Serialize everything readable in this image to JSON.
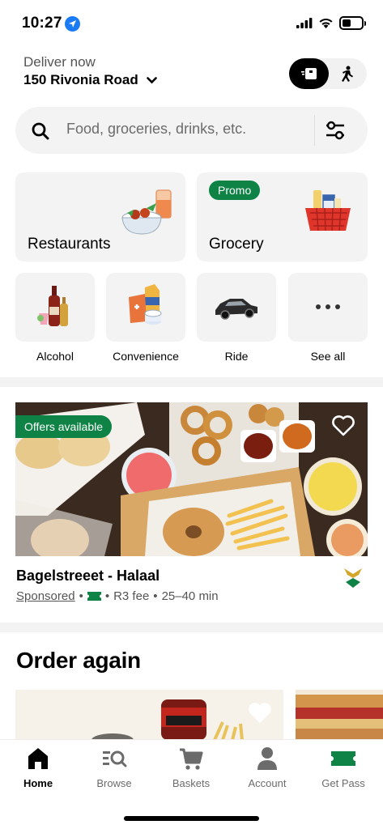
{
  "status_bar": {
    "time": "10:27",
    "battery_level": 0.45,
    "icons": [
      "location-arrow-icon",
      "cellular-signal-icon",
      "wifi-icon",
      "battery-icon"
    ]
  },
  "header": {
    "deliver_label": "Deliver now",
    "address": "150 Rivonia Road",
    "modes": [
      "delivery-icon",
      "pickup-icon"
    ],
    "active_mode": "delivery"
  },
  "search": {
    "placeholder": "Food, groceries, drinks, etc."
  },
  "categories": {
    "large": [
      {
        "label": "Restaurants",
        "badge": ""
      },
      {
        "label": "Grocery",
        "badge": "Promo"
      }
    ],
    "small": [
      {
        "label": "Alcohol"
      },
      {
        "label": "Convenience"
      },
      {
        "label": "Ride"
      },
      {
        "label": "See all"
      }
    ]
  },
  "featured": {
    "badge": "Offers available",
    "name": "Bagelstreeet - Halaal",
    "sponsored": "Sponsored",
    "fee": "R3 fee",
    "eta": "25–40 min",
    "separator": "•"
  },
  "order_again": {
    "title": "Order again"
  },
  "bottom_nav": {
    "items": [
      {
        "label": "Home",
        "icon": "home-icon"
      },
      {
        "label": "Browse",
        "icon": "browse-icon"
      },
      {
        "label": "Baskets",
        "icon": "cart-icon"
      },
      {
        "label": "Account",
        "icon": "account-icon"
      },
      {
        "label": "Get Pass",
        "icon": "pass-ticket-icon"
      }
    ],
    "active": "Home"
  },
  "colors": {
    "accent_green": "#0e8345",
    "location_blue": "#1a7cf5",
    "tile_bg": "#f3f3f3"
  }
}
